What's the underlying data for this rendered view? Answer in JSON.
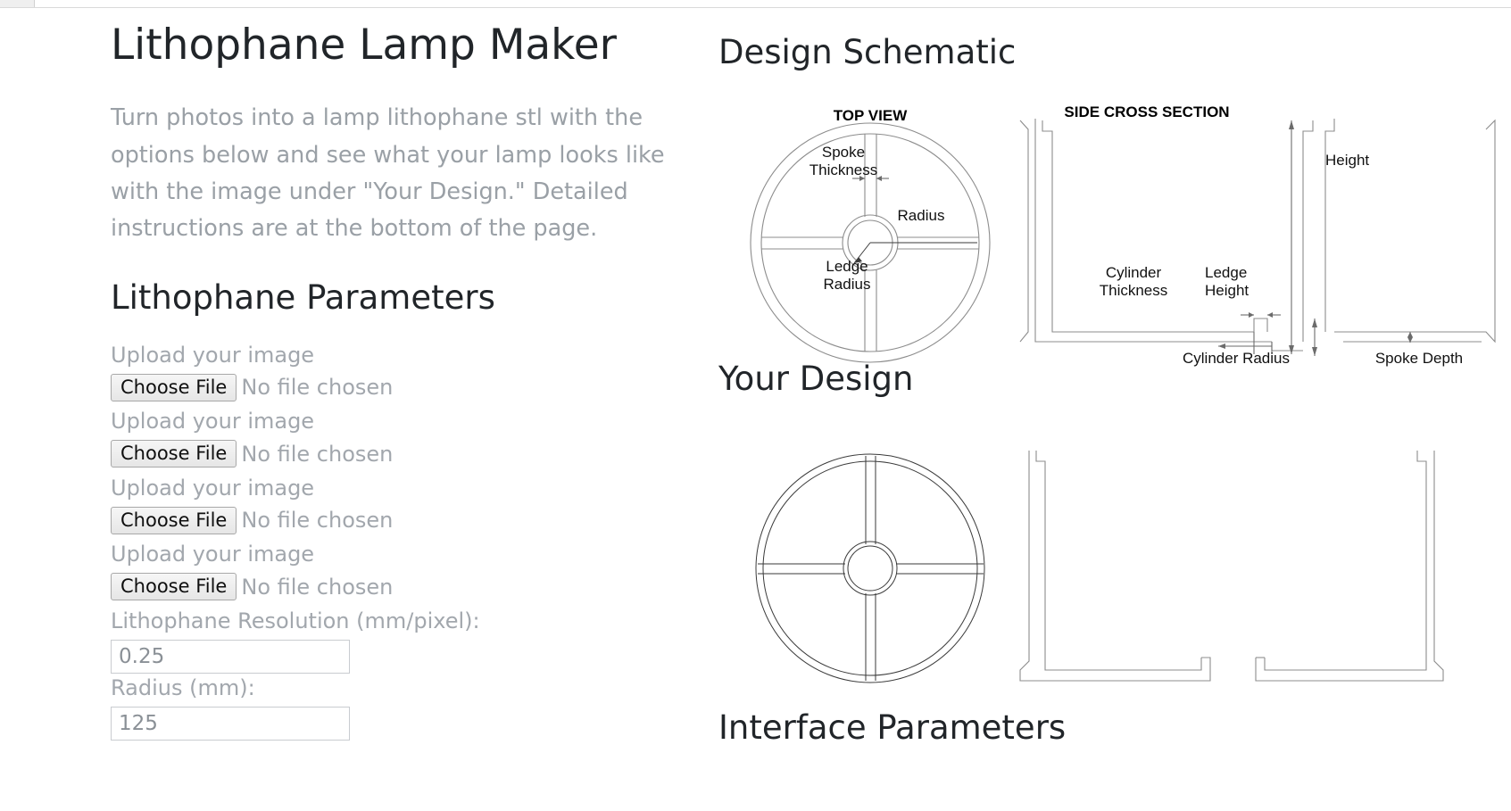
{
  "app": {
    "title": "Lithophane Lamp Maker",
    "intro": "Turn photos into a lamp lithophane stl with the options below and see what your lamp looks like with the image under \"Your Design.\" Detailed instructions are at the bottom of the page."
  },
  "left_panel": {
    "section_heading": "Lithophane Parameters",
    "uploads": [
      {
        "label": "Upload your image",
        "button": "Choose File",
        "status": "No file chosen"
      },
      {
        "label": "Upload your image",
        "button": "Choose File",
        "status": "No file chosen"
      },
      {
        "label": "Upload your image",
        "button": "Choose File",
        "status": "No file chosen"
      },
      {
        "label": "Upload your image",
        "button": "Choose File",
        "status": "No file chosen"
      }
    ],
    "numeric_fields": [
      {
        "label": "Lithophane Resolution (mm/pixel):",
        "value": "0.25"
      },
      {
        "label": "Radius (mm):",
        "value": "125"
      }
    ]
  },
  "right_panel": {
    "schematic_heading": "Design Schematic",
    "your_design_heading": "Your Design",
    "interface_heading": "Interface Parameters",
    "schematic": {
      "top_view": {
        "title": "TOP VIEW",
        "labels": [
          "Spoke Thickness",
          "Ledge Radius",
          "Radius"
        ]
      },
      "side_cross_section": {
        "title": "SIDE CROSS SECTION",
        "labels": [
          "Height",
          "Cylinder Thickness",
          "Ledge Height",
          "Cylinder Radius",
          "Spoke Depth"
        ]
      }
    }
  },
  "colors": {
    "text": "#212529",
    "muted": "#9aa0a6",
    "line": "#8c8c8c",
    "input_border": "#c9ccd0"
  }
}
